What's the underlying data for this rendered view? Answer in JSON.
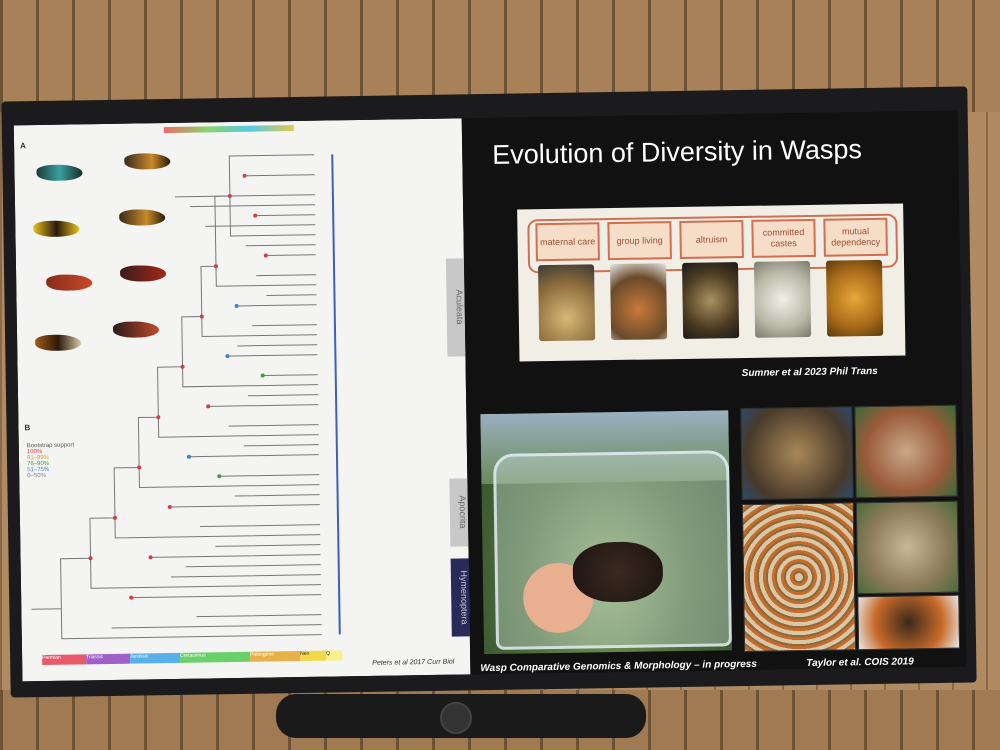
{
  "slide": {
    "title": "Evolution of Diversity in Wasps",
    "stages": [
      "maternal care",
      "group living",
      "altruism",
      "committed castes",
      "mutual dependency"
    ],
    "stages_citation": "Sumner et al 2023 Phil Trans",
    "photo_caption": "Wasp Comparative Genomics & Morphology  – in progress",
    "photo_citation": "Taylor et al. COIS 2019"
  },
  "left_panel": {
    "label_a": "A",
    "label_b": "B",
    "bootstrap_title": "Bootstrap support",
    "bootstrap_levels": [
      "100%",
      "91–99%",
      "76–90%",
      "51–75%",
      "0–50%"
    ],
    "tab_labels": [
      "Aculeata",
      "Apocrita",
      "Hymenoptera"
    ],
    "citation": "Peters et al 2017 Curr Biol",
    "geo_periods": [
      "Permian",
      "Triassic",
      "Jurassic",
      "Cretaceous",
      "Paleogene",
      "Neo",
      "Q"
    ],
    "geo_colors": [
      "#e85a6a",
      "#a060c8",
      "#58b0e8",
      "#6ad06a",
      "#e8b048",
      "#f0d848",
      "#f8f088"
    ]
  }
}
